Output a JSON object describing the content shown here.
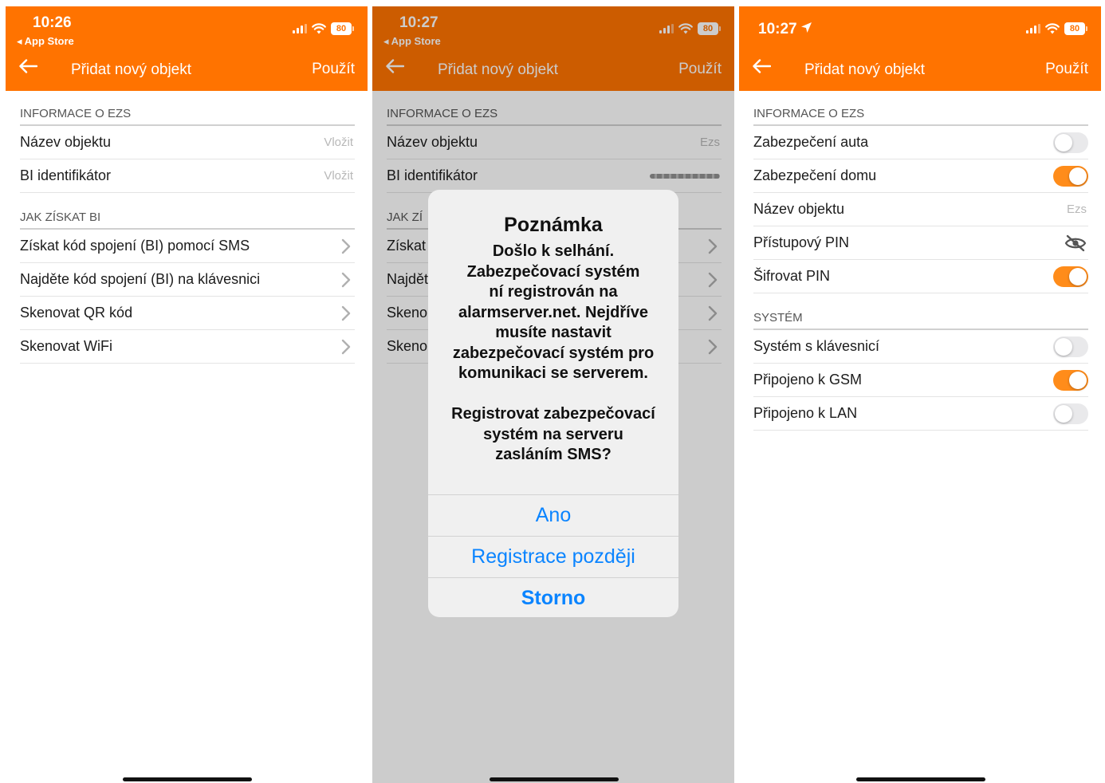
{
  "colors": {
    "accent": "#ff7300",
    "toggle_on": "#ff8c1a",
    "link_blue": "#0a84ff"
  },
  "screen1": {
    "status": {
      "time": "10:26",
      "back_app": "◂ App Store",
      "battery": "80"
    },
    "nav": {
      "title": "Přidat nový objekt",
      "action": "Použít"
    },
    "section_info": "INFORMACE O EZS",
    "rows_info": [
      {
        "label": "Název objektu",
        "value": "Vložit"
      },
      {
        "label": "BI identifikátor",
        "value": "Vložit"
      }
    ],
    "section_how": "JAK ZÍSKAT BI",
    "rows_how": [
      {
        "label": "Získat kód spojení (BI) pomocí SMS"
      },
      {
        "label": "Najděte kód spojení (BI) na klávesnici"
      },
      {
        "label": "Skenovat QR kód"
      },
      {
        "label": "Skenovat WiFi"
      }
    ]
  },
  "screen2": {
    "status": {
      "time": "10:27",
      "back_app": "◂ App Store",
      "battery": "80"
    },
    "nav": {
      "title": "Přidat nový objekt",
      "action": "Použít"
    },
    "section_info": "INFORMACE O EZS",
    "rows_info": [
      {
        "label": "Název objektu",
        "value": "Ezs"
      },
      {
        "label": "BI identifikátor"
      }
    ],
    "section_how": "JAK ZÍ",
    "rows_how": [
      {
        "label": "Získat"
      },
      {
        "label": "Najdět"
      },
      {
        "label": "Skeno"
      },
      {
        "label": "Skeno"
      }
    ],
    "alert": {
      "title": "Poznámka",
      "message": "Došlo k selhání.\nZabezpečovací systém\nní registrován na\nalarmserver.net. Nejdříve\nmusíte nastavit\nzabezpečovací systém pro\nkomunikaci se serverem.\n\nRegistrovat zabezpečovací\nsystém na serveru\nzasláním SMS?",
      "btn_yes": "Ano",
      "btn_later": "Registrace později",
      "btn_cancel": "Storno"
    }
  },
  "screen3": {
    "status": {
      "time": "10:27",
      "battery": "80"
    },
    "nav": {
      "title": "Přidat nový objekt",
      "action": "Použít"
    },
    "section_info": "INFORMACE O EZS",
    "rows_info": [
      {
        "label": "Zabezpečení auta",
        "toggle": false
      },
      {
        "label": "Zabezpečení domu",
        "toggle": true
      },
      {
        "label": "Název objektu",
        "value": "Ezs"
      },
      {
        "label": "Přístupový PIN"
      },
      {
        "label": "Šifrovat PIN",
        "toggle": true
      }
    ],
    "section_system": "SYSTÉM",
    "rows_system": [
      {
        "label": "Systém s klávesnicí",
        "toggle": false
      },
      {
        "label": "Připojeno k GSM",
        "toggle": true
      },
      {
        "label": "Připojeno k LAN",
        "toggle": false
      }
    ]
  }
}
